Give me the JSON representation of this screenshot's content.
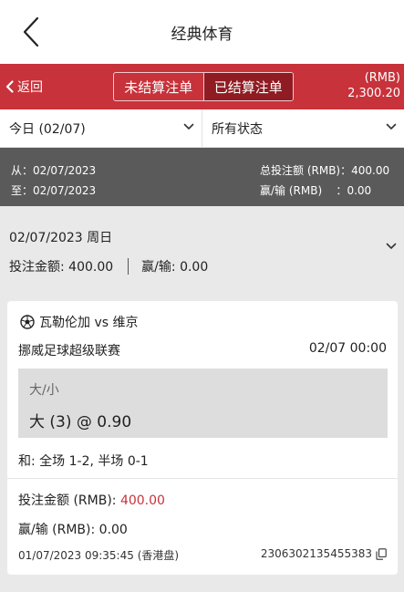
{
  "header": {
    "title": "经典体育"
  },
  "subheader": {
    "back_label": "返回",
    "tabs": [
      {
        "label": "未结算注单",
        "active": false
      },
      {
        "label": "已结算注单",
        "active": true
      }
    ],
    "currency": "(RMB)",
    "balance": "2,300.20",
    "accent_color": "#c8323a"
  },
  "filters": {
    "date_filter": "今日 (02/07)",
    "status_filter": "所有状态"
  },
  "summary": {
    "from_label": "从：",
    "from_date": "02/07/2023",
    "to_label": "至：",
    "to_date": "02/07/2023",
    "total_stake_label": "总投注额 (RMB)：",
    "total_stake_value": "400.00",
    "winloss_label": "赢/输 (RMB)",
    "winloss_sep": "：",
    "winloss_value": "0.00"
  },
  "day_group": {
    "date": "02/07/2023 周日",
    "stake_label": "投注金额: ",
    "stake_value": "400.00",
    "winloss_label": "赢/输: ",
    "winloss_value": "0.00"
  },
  "bet": {
    "match": "瓦勒伦加 vs 维京",
    "league": "挪威足球超级联赛",
    "kickoff": "02/07 00:00",
    "market": "大/小",
    "selection": "大 (3) @ 0.90",
    "result": "和: 全场 1-2, 半场 0-1",
    "stake_label": "投注金额 (RMB): ",
    "stake_value": "400.00",
    "winloss_label": "赢/输 (RMB): ",
    "winloss_value": "0.00",
    "placed_time": "01/07/2023 09:35:45 (香港盘)",
    "ticket_id": "2306302135455383"
  }
}
